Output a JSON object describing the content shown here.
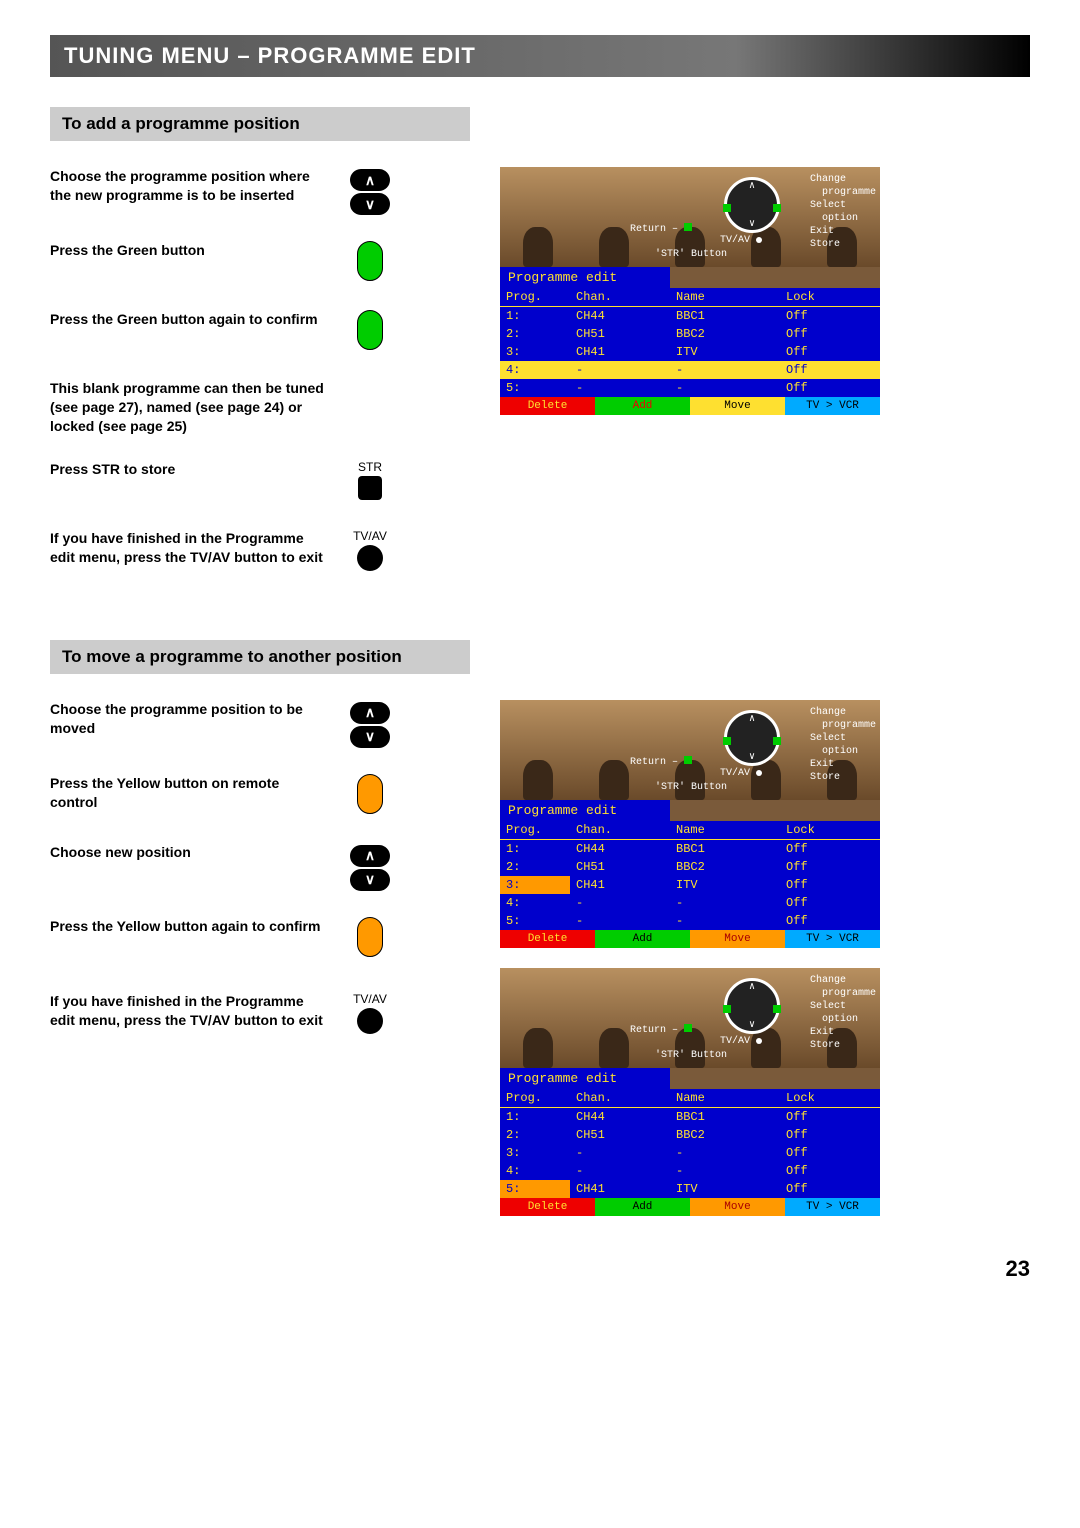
{
  "header": "TUNING MENU – PROGRAMME EDIT",
  "pageNumber": "23",
  "section1": {
    "title": "To add a programme position",
    "steps": [
      "Choose the programme position where the new programme is to be inserted",
      "Press the Green button",
      "Press the Green button again to confirm",
      "This blank programme can then be tuned (see page 27), named (see page 24) or locked (see page 25)",
      "Press STR to store",
      "If you have finished in the Programme edit menu, press the TV/AV button to exit"
    ],
    "strLabel": "STR",
    "tvavLabel": "TV/AV"
  },
  "section2": {
    "title": "To move a programme to another position",
    "steps": [
      "Choose the programme position to be moved",
      "Press the Yellow button on remote control",
      "Choose new position",
      "Press the Yellow button again to confirm",
      "If you have finished in the Programme edit menu, press the TV/AV button to exit"
    ],
    "tvavLabel": "TV/AV"
  },
  "legend": {
    "l1": "Change",
    "l2": "programme",
    "l3": "Select",
    "l4": "option",
    "l5": "Exit",
    "l6": "Store",
    "ret": "Return – ",
    "tvav": "TV/AV",
    "str": "'STR' Button"
  },
  "osd": {
    "title": "Programme edit",
    "headers": [
      "Prog.",
      "Chan.",
      "Name",
      "Lock"
    ],
    "btns": {
      "del": "Delete",
      "add": "Add",
      "mov": "Move",
      "tvv": "TV > VCR"
    }
  },
  "screen1": {
    "rows": [
      [
        "1:",
        "CH44",
        "BBC1",
        "Off"
      ],
      [
        "2:",
        "CH51",
        "BBC2",
        "Off"
      ],
      [
        "3:",
        "CH41",
        "ITV",
        "Off"
      ],
      [
        "4:",
        "-",
        "-",
        "Off"
      ],
      [
        "5:",
        "-",
        "-",
        "Off"
      ]
    ],
    "highlight": 3
  },
  "screen2": {
    "rows": [
      [
        "1:",
        "CH44",
        "BBC1",
        "Off"
      ],
      [
        "2:",
        "CH51",
        "BBC2",
        "Off"
      ],
      [
        "3:",
        "CH41",
        "ITV",
        "Off"
      ],
      [
        "4:",
        "-",
        "-",
        "Off"
      ],
      [
        "5:",
        "-",
        "-",
        "Off"
      ]
    ],
    "highlightOrange": 2
  },
  "screen3": {
    "rows": [
      [
        "1:",
        "CH44",
        "BBC1",
        "Off"
      ],
      [
        "2:",
        "CH51",
        "BBC2",
        "Off"
      ],
      [
        "3:",
        "-",
        "-",
        "Off"
      ],
      [
        "4:",
        "-",
        "-",
        "Off"
      ],
      [
        "5:",
        "CH41",
        "ITV",
        "Off"
      ]
    ],
    "highlightOrange": 4
  }
}
